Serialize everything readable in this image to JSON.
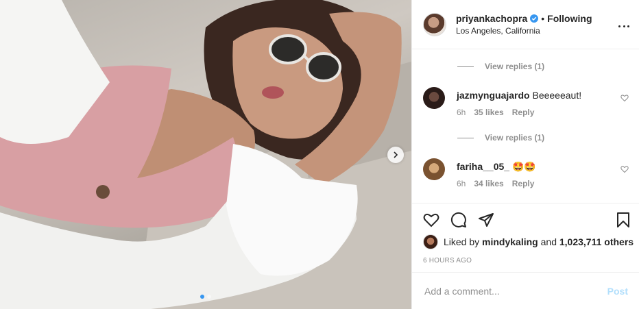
{
  "header": {
    "username": "priyankachopra",
    "separator": "•",
    "follow_status": "Following",
    "location": "Los Angeles, California"
  },
  "comments": {
    "view_replies_1": "View replies (1)",
    "items": [
      {
        "username": "jazmynguajardo",
        "text": "Beeeeeaut!",
        "age": "6h",
        "likes": "35 likes",
        "reply": "Reply",
        "avatar_color": "#2a1b18"
      },
      {
        "username": "fariha__05_",
        "text": "🤩🤩",
        "age": "6h",
        "likes": "34 likes",
        "reply": "Reply",
        "avatar_color": "#b48a52"
      }
    ],
    "view_replies_2": "View replies (1)"
  },
  "likes": {
    "prefix": "Liked by",
    "user": "mindykaling",
    "middle": "and",
    "count": "1,023,711 others"
  },
  "timestamp": "6 HOURS AGO",
  "add_comment": {
    "placeholder": "Add a comment...",
    "post_label": "Post"
  },
  "carousel": {
    "slides": 2,
    "current": 1
  },
  "colors": {
    "accent": "#3897f0",
    "post_disabled": "#b2dffc",
    "muted": "#8e8e8e"
  }
}
